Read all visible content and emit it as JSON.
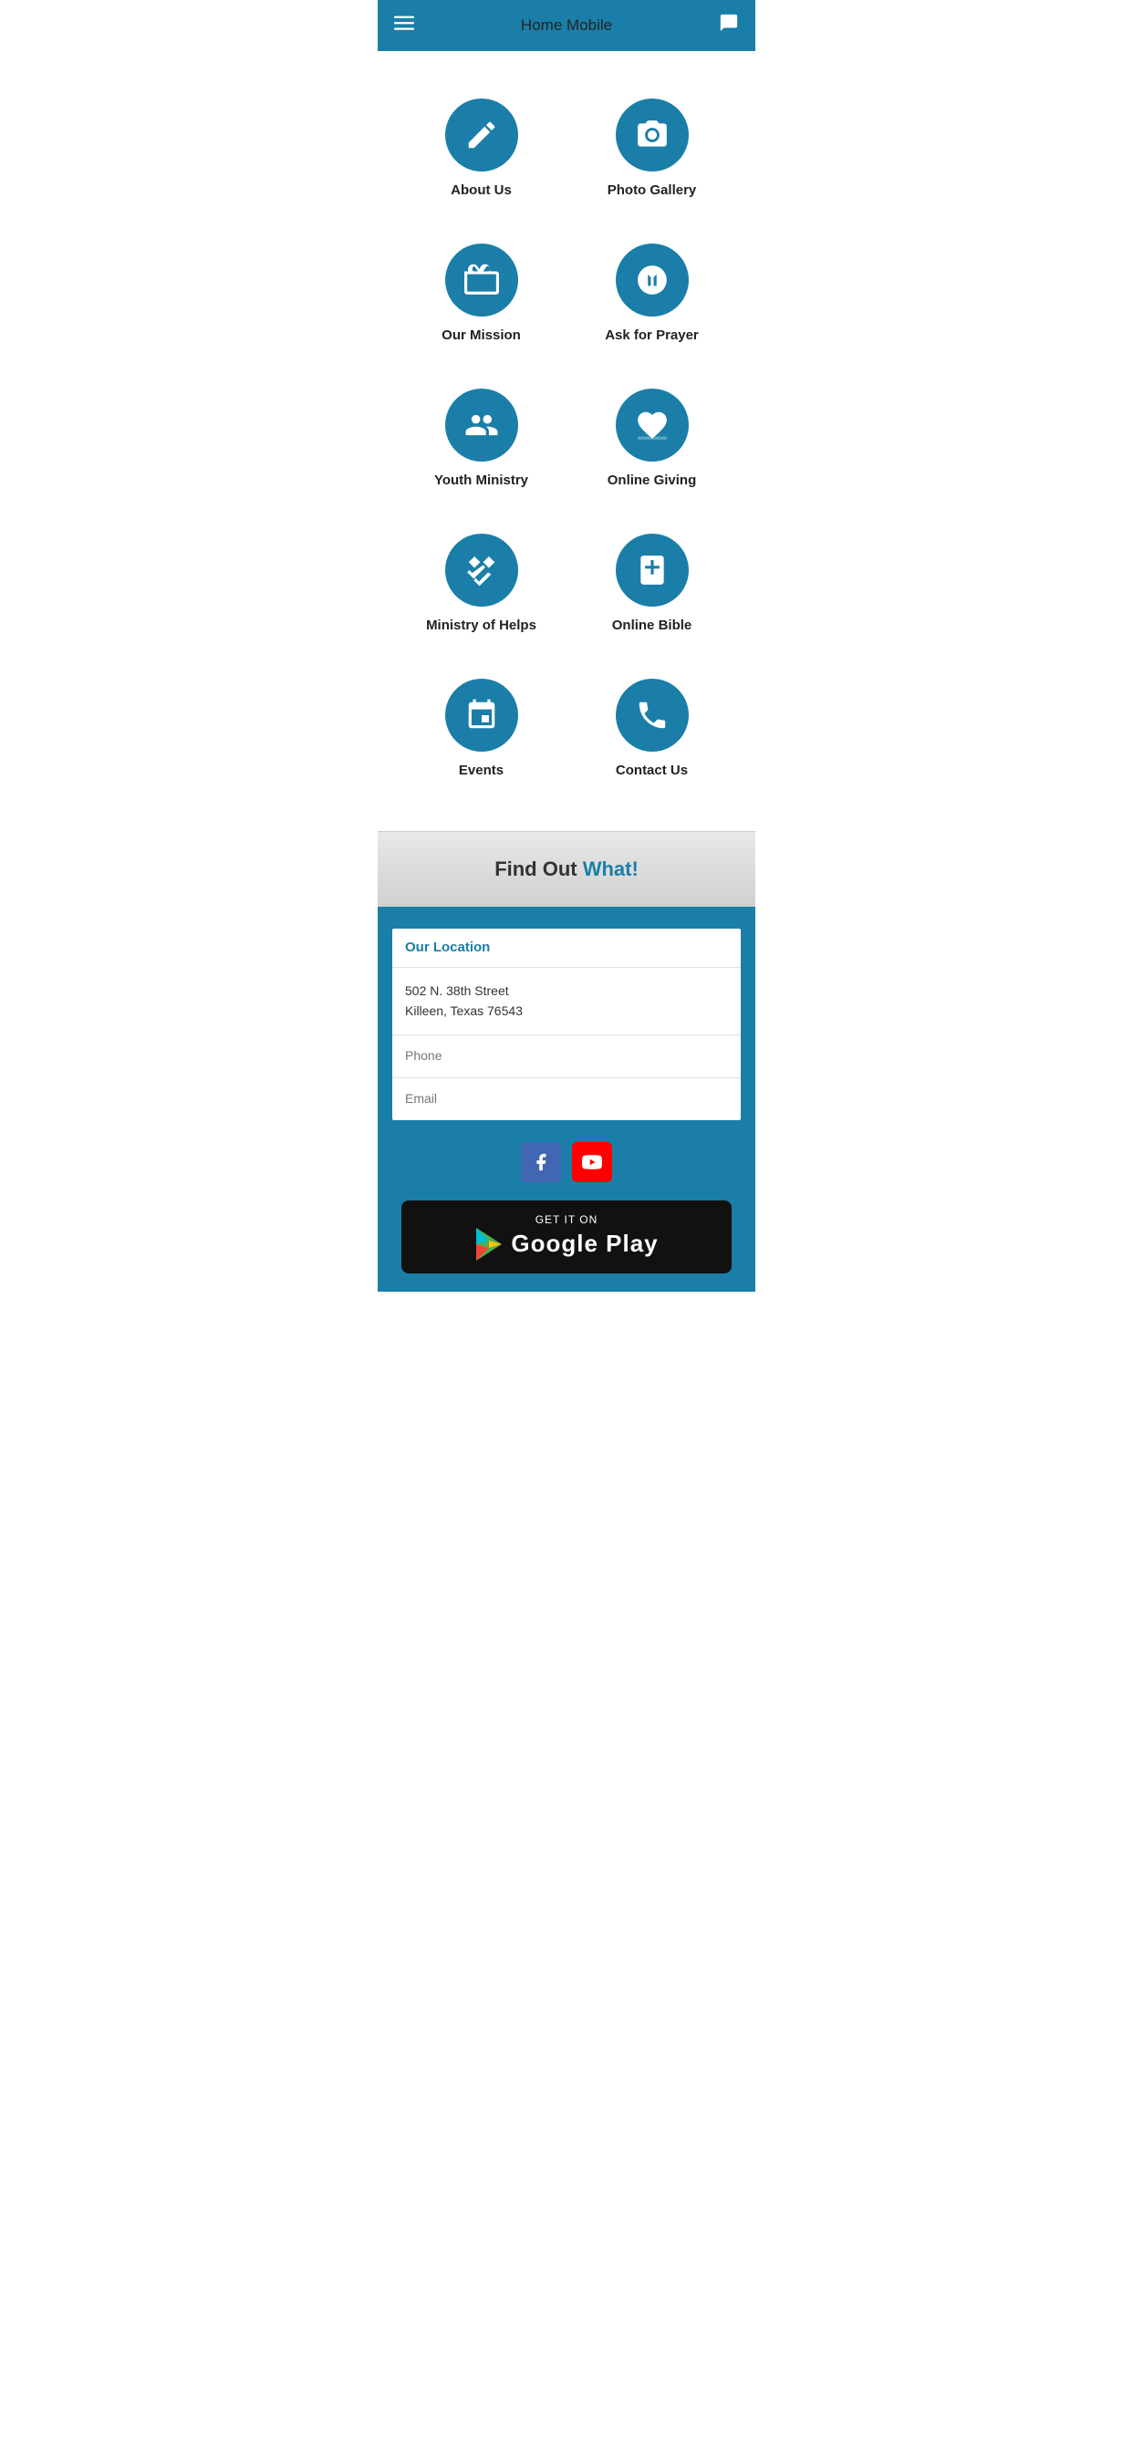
{
  "header": {
    "title": "Home Mobile"
  },
  "menu": {
    "items": [
      {
        "id": "about-us",
        "label": "About Us",
        "icon": "pencil"
      },
      {
        "id": "photo-gallery",
        "label": "Photo Gallery",
        "icon": "camera"
      },
      {
        "id": "our-mission",
        "label": "Our Mission",
        "icon": "briefcase"
      },
      {
        "id": "ask-for-prayer",
        "label": "Ask for Prayer",
        "icon": "praying-hands"
      },
      {
        "id": "youth-ministry",
        "label": "Youth Ministry",
        "icon": "people"
      },
      {
        "id": "online-giving",
        "label": "Online Giving",
        "icon": "heart-hand"
      },
      {
        "id": "ministry-of-helps",
        "label": "Ministry of Helps",
        "icon": "handshake"
      },
      {
        "id": "online-bible",
        "label": "Online Bible",
        "icon": "bible"
      },
      {
        "id": "events",
        "label": "Events",
        "icon": "calendar"
      },
      {
        "id": "contact-us",
        "label": "Contact Us",
        "icon": "phone"
      }
    ]
  },
  "find_out": {
    "text": "Find Out ",
    "highlight": "What!"
  },
  "location": {
    "card_title": "Our Location",
    "address_line1": "502 N. 38th Street",
    "address_line2": "Killeen, Texas 76543",
    "phone_placeholder": "Phone",
    "email_placeholder": "Email"
  },
  "social": {
    "facebook_label": "Facebook",
    "youtube_label": "YouTube"
  },
  "google_play": {
    "get_it_on": "GET IT ON",
    "store_name": "Google Play"
  }
}
